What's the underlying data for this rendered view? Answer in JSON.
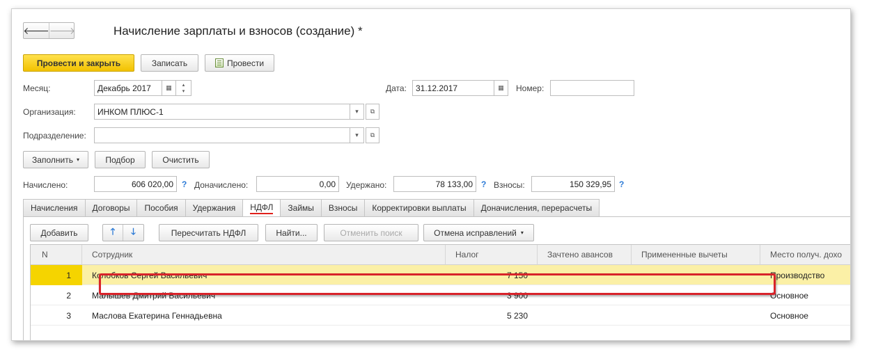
{
  "window": {
    "title": "Начисление зарплаты и взносов (создание) *"
  },
  "nav": {
    "back_icon": "arrow-left-icon",
    "forward_icon": "arrow-right-icon"
  },
  "toolbar": {
    "post_close": "Провести и закрыть",
    "save": "Записать",
    "post": "Провести"
  },
  "form": {
    "month_label": "Месяц:",
    "month_value": "Декабрь 2017",
    "date_label": "Дата:",
    "date_value": "31.12.2017",
    "number_label": "Номер:",
    "number_value": "",
    "org_label": "Организация:",
    "org_value": "ИНКОМ ПЛЮС-1",
    "dept_label": "Подразделение:",
    "dept_value": ""
  },
  "actions": {
    "fill": "Заполнить",
    "pick": "Подбор",
    "clear": "Очистить"
  },
  "totals": {
    "accrued_label": "Начислено:",
    "accrued_value": "606 020,00",
    "extra_label": "Доначислено:",
    "extra_value": "0,00",
    "withheld_label": "Удержано:",
    "withheld_value": "78 133,00",
    "contrib_label": "Взносы:",
    "contrib_value": "150 329,95",
    "help": "?"
  },
  "tabs": [
    "Начисления",
    "Договоры",
    "Пособия",
    "Удержания",
    "НДФЛ",
    "Займы",
    "Взносы",
    "Корректировки выплаты",
    "Доначисления, перерасчеты"
  ],
  "active_tab": "НДФЛ",
  "grid_toolbar": {
    "add": "Добавить",
    "recalc": "Пересчитать НДФЛ",
    "find": "Найти...",
    "cancel_search": "Отменить поиск",
    "undo_fixes": "Отмена исправлений"
  },
  "grid": {
    "columns": [
      "N",
      "Сотрудник",
      "Налог",
      "Зачтено авансов",
      "Примененные вычеты",
      "Место получ. дохо"
    ],
    "rows": [
      {
        "n": "1",
        "employee": "Колобков Сергей Васильевич",
        "tax": "7 150",
        "advances": "",
        "deductions": "",
        "place": "Производство"
      },
      {
        "n": "2",
        "employee": "Малышев Дмитрий Васильевич",
        "tax": "3 900",
        "advances": "",
        "deductions": "",
        "place": "Основное"
      },
      {
        "n": "3",
        "employee": "Маслова Екатерина Геннадьевна",
        "tax": "5 230",
        "advances": "",
        "deductions": "",
        "place": "Основное"
      }
    ]
  },
  "colors": {
    "primary": "#f2c200",
    "selected_row": "#fbf0a6",
    "highlight": "#d8232a",
    "help": "#2c7ad6"
  }
}
